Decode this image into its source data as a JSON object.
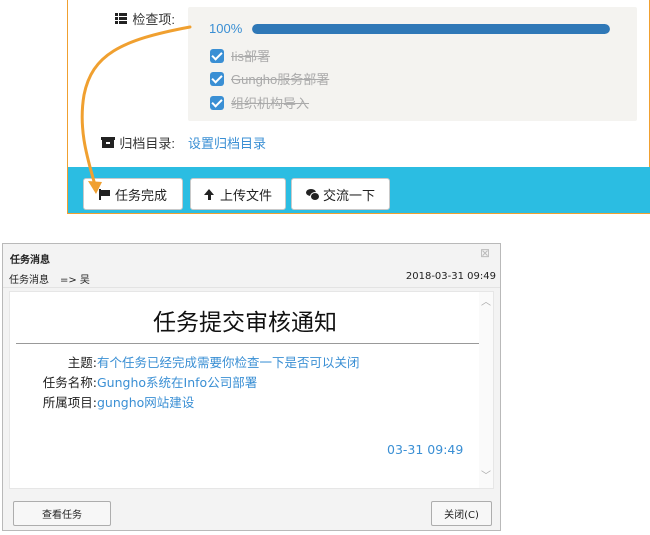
{
  "task": {
    "check_label": "检查项:",
    "progress": {
      "percent_text": "100%",
      "value": 1.0
    },
    "check_items": [
      {
        "label": "Iis部署",
        "checked": true
      },
      {
        "label": "Gungho服务部署",
        "checked": true
      },
      {
        "label": "组织机构导入",
        "checked": true
      }
    ],
    "archive_label": "归档目录:",
    "archive_link": "设置归档目录",
    "buttons": {
      "complete": "任务完成",
      "upload": "上传文件",
      "discuss": "交流一下"
    },
    "colors": {
      "action_bar": "#2bbde2",
      "accent": "#3a8fd4",
      "progress": "#2f78b7",
      "arrow": "#f0a030"
    }
  },
  "dialog": {
    "title": "任务消息",
    "close_icon": "close-icon",
    "from": "任务消息",
    "to": "=> 吴",
    "time": "2018-03-31 09:49",
    "notice_title": "任务提交审核通知",
    "fields": [
      {
        "key": "主题:",
        "value": "有个任务已经完成需要你检查一下是否可以关闭"
      },
      {
        "key": "任务名称:",
        "value": "Gungho系统在Info公司部署"
      },
      {
        "key": "所属项目:",
        "value": "gungho网站建设"
      }
    ],
    "date": "03-31 09:49",
    "view_button": "查看任务",
    "close_button": "关闭(C)"
  }
}
